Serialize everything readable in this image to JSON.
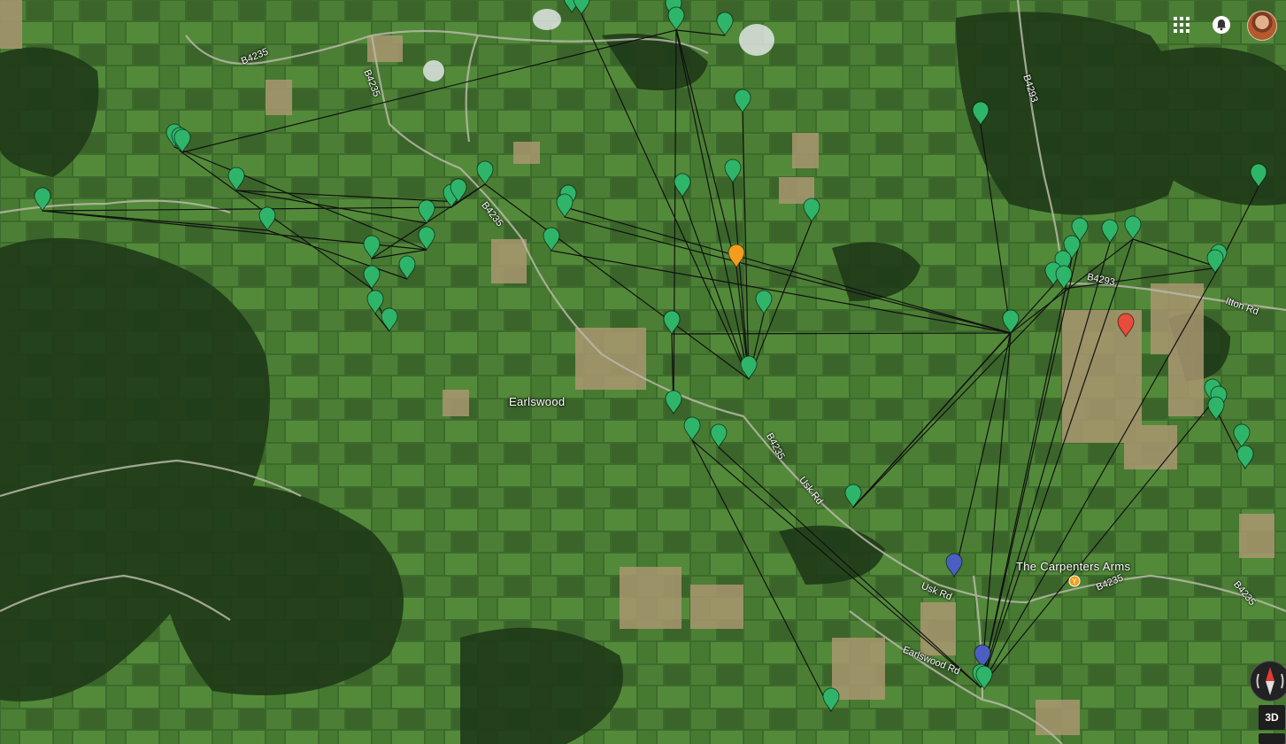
{
  "labels": {
    "place": "Earlswood",
    "poi": "The Carpenters Arms"
  },
  "roads": [
    "B4235",
    "B4235",
    "B4235",
    "B4235",
    "B4293",
    "B4293",
    "Itton Rd",
    "Usk Rd",
    "Usk Rd",
    "Earlswood Rd",
    "B4235",
    "B4235"
  ],
  "controls": {
    "apps_icon": "apps-grid-icon",
    "notifications_icon": "bell-icon",
    "view_3d": "3D"
  },
  "colors": {
    "marker_default": "#2fb56a",
    "marker_highlight_orange": "#f39c1f",
    "marker_highlight_red": "#e74c3c",
    "marker_highlight_blue": "#4a5fbf",
    "poi_orange": "#f0a020"
  }
}
